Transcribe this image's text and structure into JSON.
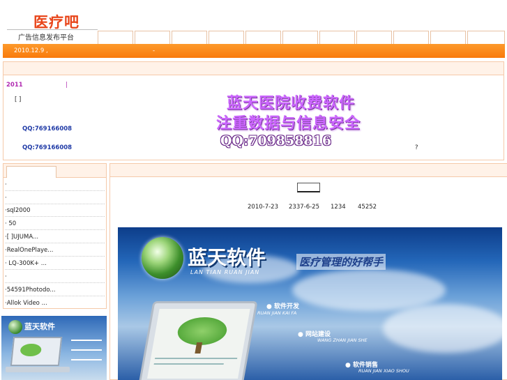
{
  "logo": {
    "title": "医疗吧",
    "subtitle": "广告信息发布平台"
  },
  "announcement": {
    "date": "2010.12.9 ,",
    "dash": "-"
  },
  "info": {
    "year": "2011",
    "bar": "|",
    "bracket": "[     ]",
    "qq1": "QQ:769166008",
    "qq2": "QQ:769166008",
    "question": "?"
  },
  "ad": {
    "line1": "蓝天医院收费软件",
    "line2": "注重数据与信息安全",
    "qq": "QQ:709858816"
  },
  "sidebar": {
    "items": [
      {
        "label": "·"
      },
      {
        "label": "·"
      },
      {
        "label": "·sql2000"
      },
      {
        "label": "·      50"
      },
      {
        "label": "·[  ]UJUMA..."
      },
      {
        "label": "·RealOnePlaye..."
      },
      {
        "label": "·   LQ-300K+ ..."
      },
      {
        "label": "·"
      },
      {
        "label": "·54591Photodo..."
      },
      {
        "label": "·Allok Video ..."
      }
    ]
  },
  "thumb": {
    "brand": "蓝天软件"
  },
  "stats": {
    "date1": "2010-7-23",
    "date2": "2337-6-25",
    "n1": "1234",
    "n2": "45252"
  },
  "banner": {
    "brand": "蓝天软件",
    "pinyin": "LAN TIAN RUAN JIAN",
    "slogan": "医疗管理的好帮手",
    "service1": "● 软件开发",
    "service1_py": "RUAN JIAN KAI FA",
    "service2": "● 网站建设",
    "service2_py": "WANG ZHAN JIAN SHE",
    "service3": "● 软件销售",
    "service3_py": "RUAN JIAN XIAO SHOU"
  }
}
